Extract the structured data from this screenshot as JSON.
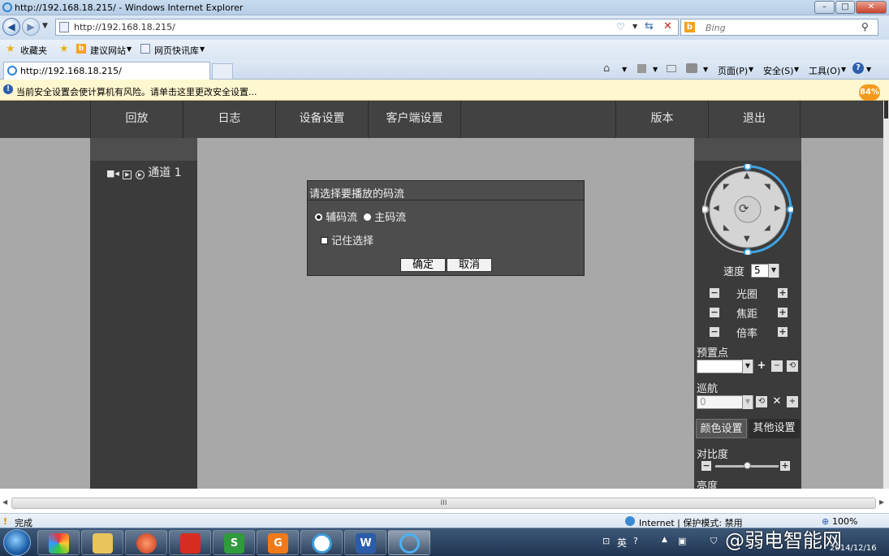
{
  "window": {
    "title": "http://192.168.18.215/ - Windows Internet Explorer",
    "minimize": "–",
    "maximize": "□",
    "close": "✕"
  },
  "addressbar": {
    "url": "http://192.168.18.215/",
    "search_placeholder": "Bing"
  },
  "favorites_bar": {
    "favorites": "收藏夹",
    "suggested_sites": "建议网站",
    "web_slice_gallery": "网页快讯库"
  },
  "tabs": [
    {
      "label": "http://192.168.18.215/"
    }
  ],
  "command_bar": {
    "page": "页面(P)",
    "safety": "安全(S)",
    "tools": "工具(O)"
  },
  "info_bar": {
    "message": "当前安全设置会使计算机有风险。请单击这里更改安全设置...",
    "badge": "84%"
  },
  "app_menu": {
    "items": [
      "回放",
      "日志",
      "设备设置",
      "客户端设置",
      "版本",
      "退出"
    ]
  },
  "left_panel": {
    "channel_label": "通道 1"
  },
  "stream_dialog": {
    "title": "请选择要播放的码流",
    "options": [
      "辅码流",
      "主码流"
    ],
    "selected": "辅码流",
    "remember_label": "记住选择",
    "remember_checked": false,
    "ok_label": "确定",
    "cancel_label": "取消"
  },
  "ptz_panel": {
    "speed_label": "速度",
    "speed_value": "5",
    "iris_label": "光圈",
    "focus_label": "焦距",
    "zoom_label": "倍率",
    "preset_label": "预置点",
    "preset_value": "",
    "cruise_label": "巡航",
    "cruise_value": "0",
    "tab_color": "颜色设置",
    "tab_other": "其他设置",
    "contrast_label": "对比度",
    "contrast_level": 0.5,
    "brightness_label": "亮度"
  },
  "status_bar": {
    "status": "完成",
    "zone": "Internet | 保护模式: 禁用",
    "zoom": "100%",
    "hscroll_grip": "III"
  },
  "taskbar": {
    "ime": "英",
    "date": "2014/12/16"
  },
  "watermark": "@弱电智能网",
  "colors": {
    "menu_bg": "#424242",
    "panel_bg": "#3b3b3b",
    "content_bg": "#a8a8a8",
    "ptz_ring": "#3da3e6"
  }
}
